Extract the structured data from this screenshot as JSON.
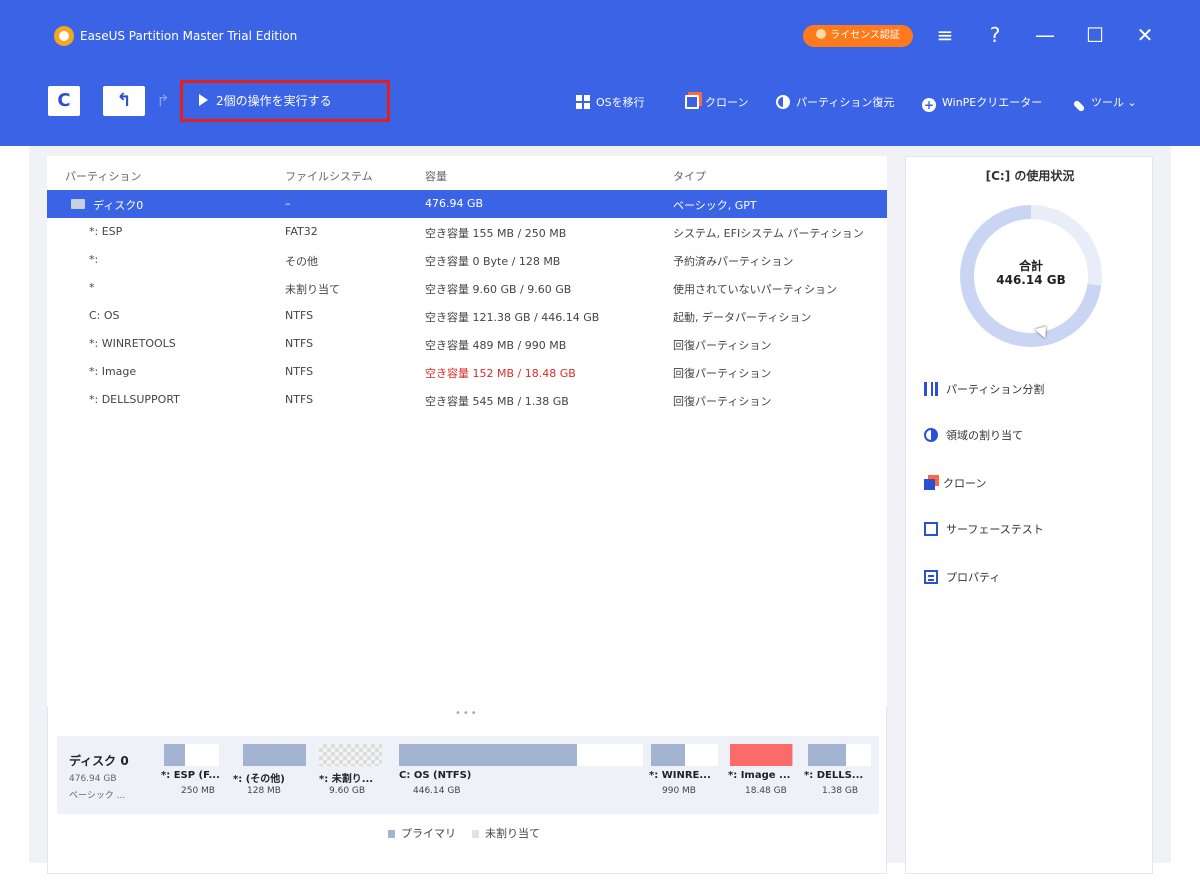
{
  "window": {
    "title": "EaseUS Partition Master Trial Edition",
    "license_label": "ライセンス認証",
    "controls": [
      "≡",
      "?",
      "—",
      "☐",
      "✕"
    ]
  },
  "toolbar": {
    "refresh": "C",
    "undo": "↰",
    "redo": "↱",
    "execute_label": "2個の操作を実行する",
    "items": [
      {
        "label": "OSを移行",
        "icon": "grid-icon"
      },
      {
        "label": "クローン",
        "icon": "clone-icon"
      },
      {
        "label": "パーティション復元",
        "icon": "pie-icon"
      },
      {
        "label": "WinPEクリエーター",
        "icon": "plus-circle-icon"
      },
      {
        "label": "ツール",
        "icon": "wrench-icon"
      }
    ],
    "tools_chevron": "⌄"
  },
  "table": {
    "headers": [
      "パーティション",
      "ファイルシステム",
      "容量",
      "タイプ"
    ],
    "rows": [
      {
        "name": "ディスク0",
        "fs": "–",
        "capacity": "476.94 GB",
        "type": "ベーシック, GPT",
        "selected": true,
        "warn": false
      },
      {
        "name": "*: ESP",
        "fs": "FAT32",
        "capacity": "空き容量 155 MB / 250 MB",
        "type": "システム, EFIシステム パーティション",
        "selected": false,
        "warn": false
      },
      {
        "name": "*:",
        "fs": "その他",
        "capacity": "空き容量 0 Byte / 128 MB",
        "type": "予約済みパーティション",
        "selected": false,
        "warn": false
      },
      {
        "name": "*",
        "fs": "未割り当て",
        "capacity": "空き容量 9.60 GB / 9.60 GB",
        "type": "使用されていないパーティション",
        "selected": false,
        "warn": false
      },
      {
        "name": "C: OS",
        "fs": "NTFS",
        "capacity": "空き容量 121.38 GB / 446.14 GB",
        "type": "起動, データパーティション",
        "selected": false,
        "warn": false
      },
      {
        "name": "*: WINRETOOLS",
        "fs": "NTFS",
        "capacity": "空き容量 489 MB / 990 MB",
        "type": "回復パーティション",
        "selected": false,
        "warn": false
      },
      {
        "name": "*: Image",
        "fs": "NTFS",
        "capacity": "空き容量 152 MB / 18.48 GB",
        "type": "回復パーティション",
        "selected": false,
        "warn": true
      },
      {
        "name": "*: DELLSUPPORT",
        "fs": "NTFS",
        "capacity": "空き容量 545 MB / 1.38 GB",
        "type": "回復パーティション",
        "selected": false,
        "warn": false
      }
    ]
  },
  "splitter": "•••",
  "diskmap": {
    "title": "ディスク 0",
    "size": "476.94 GB",
    "kind": "ベーシック ...",
    "segments": [
      {
        "name": "*: ESP (F...",
        "size": "250 MB",
        "fill": 0.38,
        "color": "#a3b4d3"
      },
      {
        "name": "*: (その他)",
        "size": "128 MB",
        "fill": 1.0,
        "color": "#a3b4d3"
      },
      {
        "name": "*: 未割り...",
        "size": "9.60 GB",
        "fill": 0,
        "color": "#d8d8d8"
      },
      {
        "name": "C: OS (NTFS)",
        "size": "446.14 GB",
        "fill": 0.73,
        "color": "#a3b4d3"
      },
      {
        "name": "*: WINRE...",
        "size": "990 MB",
        "fill": 0.51,
        "color": "#a3b4d3"
      },
      {
        "name": "*: Image ...",
        "size": "18.48 GB",
        "fill": 0.99,
        "color": "#fb6b6b"
      },
      {
        "name": "*: DELLS...",
        "size": "1.38 GB",
        "fill": 0.6,
        "color": "#a3b4d3"
      }
    ],
    "legend": [
      "プライマリ",
      "未割り当て"
    ]
  },
  "side": {
    "title": "[C:] の使用状況",
    "donut_label": "合計",
    "donut_value": "446.14 GB",
    "used_fraction": 0.728,
    "actions": [
      {
        "label": "パーティション分割",
        "icon": "split-icon"
      },
      {
        "label": "領域の割り当て",
        "icon": "allocate-icon"
      },
      {
        "label": "クローン",
        "icon": "clone-icon"
      },
      {
        "label": "サーフェーステスト",
        "icon": "surface-test-icon"
      },
      {
        "label": "プロパティ",
        "icon": "properties-icon"
      }
    ]
  }
}
